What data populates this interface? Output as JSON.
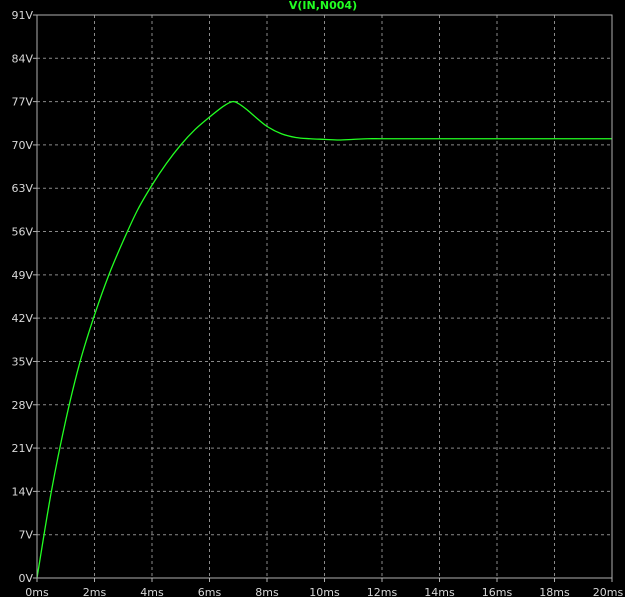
{
  "chart_data": {
    "type": "line",
    "title": "V(IN,N004)",
    "xlabel": "",
    "ylabel": "",
    "xlim": [
      0,
      20
    ],
    "ylim": [
      0,
      91
    ],
    "x_ticks": [
      0,
      2,
      4,
      6,
      8,
      10,
      12,
      14,
      16,
      18,
      20
    ],
    "x_tick_labels": [
      "0ms",
      "2ms",
      "4ms",
      "6ms",
      "8ms",
      "10ms",
      "12ms",
      "14ms",
      "16ms",
      "18ms",
      "20ms"
    ],
    "y_ticks": [
      0,
      7,
      14,
      21,
      28,
      35,
      42,
      49,
      56,
      63,
      70,
      77,
      84,
      91
    ],
    "y_tick_labels": [
      "0V",
      "7V",
      "14V",
      "21V",
      "28V",
      "35V",
      "42V",
      "49V",
      "56V",
      "63V",
      "70V",
      "77V",
      "84V",
      "91V"
    ],
    "grid": true,
    "background": "#000000",
    "grid_color": "#8a8a8a",
    "axis_color": "#b0b0b0",
    "series": [
      {
        "name": "V(IN,N004)",
        "color": "#22ff22",
        "x": [
          0,
          0.5,
          1,
          1.5,
          2,
          2.5,
          3,
          3.5,
          4,
          4.5,
          5,
          5.5,
          6,
          6.5,
          6.8,
          7,
          7.3,
          7.6,
          8,
          8.5,
          9,
          9.5,
          10,
          10.5,
          11,
          11.5,
          12,
          13,
          14,
          15,
          16,
          17,
          18,
          19,
          20
        ],
        "y": [
          0,
          14,
          25.5,
          35,
          42.5,
          49,
          54.5,
          59.5,
          63.5,
          67,
          70,
          72.5,
          74.5,
          76.3,
          77,
          76.7,
          75.7,
          74.5,
          73,
          71.8,
          71.2,
          71,
          70.9,
          70.8,
          70.9,
          71,
          71,
          71,
          71,
          71,
          71,
          71,
          71,
          71,
          71
        ]
      }
    ]
  }
}
